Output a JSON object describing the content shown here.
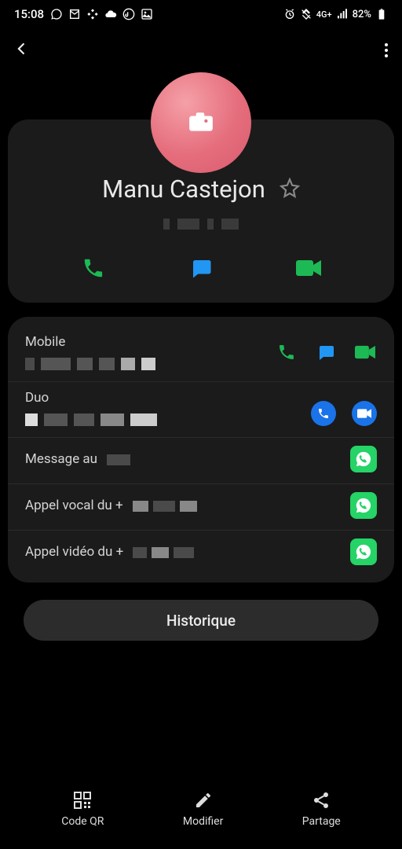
{
  "status": {
    "time": "15:08",
    "battery": "82%",
    "network": "4G+"
  },
  "contact": {
    "name": "Manu Castejon"
  },
  "rows": {
    "mobile_label": "Mobile",
    "duo_label": "Duo",
    "message_label": "Message au",
    "voice_call_label": "Appel vocal du +",
    "video_call_label": "Appel vidéo du +"
  },
  "history_button": "Historique",
  "bottom": {
    "qr": "Code QR",
    "edit": "Modifier",
    "share": "Partage"
  }
}
